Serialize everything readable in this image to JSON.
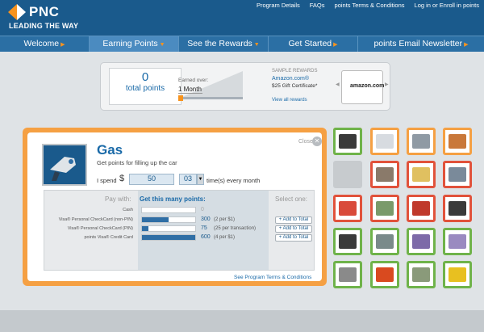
{
  "header": {
    "brand": "PNC",
    "tagline": "LEADING THE WAY",
    "links": [
      "Program Details",
      "FAQs",
      "points Terms & Conditions",
      "Log in or Enroll in points"
    ]
  },
  "nav": {
    "items": [
      {
        "label": "Welcome",
        "width": 111,
        "active": false
      },
      {
        "label": "Earning Points",
        "width": 111,
        "active": true
      },
      {
        "label": "See the Rewards",
        "width": 111,
        "active": false
      },
      {
        "label": "Get Started",
        "width": 111,
        "active": false
      },
      {
        "label": "points Email Newsletter",
        "width": 156,
        "active": false
      }
    ]
  },
  "summary": {
    "points": "0",
    "points_label": "total points",
    "earned_over_label": "Earned over:",
    "earned_over_value": "1 Month",
    "sample_title": "SAMPLE REWARDS",
    "sample_name": "Amazon.com®",
    "sample_desc": "$25 Gift Certificate*",
    "view_all": "View all rewards",
    "reward_brand": "amazon.com"
  },
  "calculator": {
    "close_label": "Close",
    "category": "Gas",
    "subtitle": "Get points for filling up the car",
    "spend_label": "I spend",
    "currency": "$",
    "amount": "50",
    "times": "03",
    "times_label": "time(s) every month",
    "pay_with_label": "Pay with:",
    "get_points_label": "Get this many points:",
    "select_one_label": "Select one:",
    "rows": [
      {
        "label": "Cash",
        "value": "0",
        "note": "",
        "fill": 0,
        "button": ""
      },
      {
        "label": "Visa® Personal CheckCard (non-PIN)",
        "value": "300",
        "note": "(2 per $1)",
        "fill": 0.5,
        "button": "+ Add to Total"
      },
      {
        "label": "Visa® Personal CheckCard (PIN)",
        "value": "75",
        "note": "(25 per transaction)",
        "fill": 0.125,
        "button": "+ Add to Total"
      },
      {
        "label": "points Visa® Credit Card",
        "value": "600",
        "note": "(4 per $1)",
        "fill": 1.0,
        "button": "+ Add to Total"
      }
    ],
    "terms_link": "See Program Terms & Conditions"
  },
  "categories": {
    "tiles": [
      {
        "name": "phone-tile",
        "color": "orange",
        "icon_color": "#b9c1c8"
      },
      {
        "name": "medicine-tile",
        "color": "orange",
        "icon_color": "#d7dbe0"
      },
      {
        "name": "car-tile",
        "color": "orange",
        "icon_color": "#8f9aa4"
      },
      {
        "name": "groceries-tile",
        "color": "orange",
        "icon_color": "#c9783a"
      },
      {
        "name": "blank-tile",
        "color": "blank",
        "icon_color": "#c7cbce"
      },
      {
        "name": "house-tile",
        "color": "red",
        "icon_color": "#8a7a6a"
      },
      {
        "name": "education-tile",
        "color": "red",
        "icon_color": "#e0c060"
      },
      {
        "name": "school-tile",
        "color": "red",
        "icon_color": "#7a8a9a"
      },
      {
        "name": "popcorn-tile",
        "color": "red",
        "icon_color": "#d94a3a"
      },
      {
        "name": "tickets-tile",
        "color": "red",
        "icon_color": "#7a9a6a"
      },
      {
        "name": "luggage-tile",
        "color": "red",
        "icon_color": "#c0392b"
      },
      {
        "name": "suitcase-tile",
        "color": "red",
        "icon_color": "#3a3a3a"
      },
      {
        "name": "telephone-tile",
        "color": "green",
        "icon_color": "#3a3a3a"
      },
      {
        "name": "satellite-tile",
        "color": "green",
        "icon_color": "#7a8a8a"
      },
      {
        "name": "bills-tile",
        "color": "green",
        "icon_color": "#7d6aa8"
      },
      {
        "name": "statements-tile",
        "color": "green",
        "icon_color": "#9a8ac0"
      },
      {
        "name": "building-tile",
        "color": "green",
        "icon_color": "#8a8a8a"
      },
      {
        "name": "gas-tile",
        "color": "green",
        "icon_color": "#d94a1f"
      },
      {
        "name": "home-tile",
        "color": "green",
        "icon_color": "#8a9a7a"
      },
      {
        "name": "van-tile",
        "color": "green",
        "icon_color": "#e8c020"
      },
      {
        "name": "chair-tile",
        "color": "green",
        "icon_color": "#3a3a3a"
      }
    ]
  },
  "colors": {
    "brand_blue": "#1a5a8c",
    "accent_orange": "#f5a043",
    "link_blue": "#1a6aa8"
  }
}
